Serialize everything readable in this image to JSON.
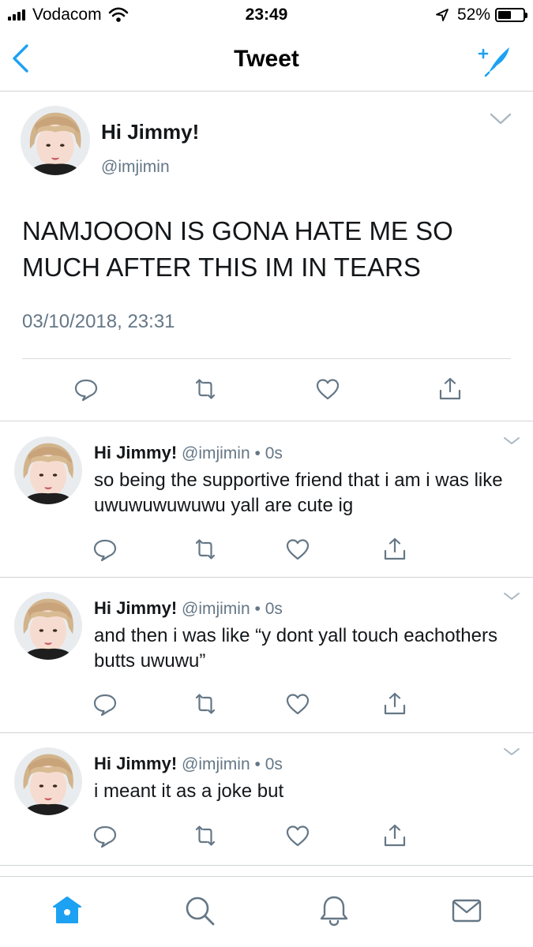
{
  "status_bar": {
    "carrier": "Vodacom",
    "time": "23:49",
    "battery": "52%",
    "battery_level": 0.52,
    "icons": [
      "signal-icon",
      "wifi-icon",
      "location-arrow-icon",
      "battery-icon"
    ]
  },
  "nav": {
    "title": "Tweet",
    "back_icon": "chevron-left-icon",
    "compose_icon": "compose-feather-icon"
  },
  "colors": {
    "accent": "#1da1f2",
    "secondary_text": "#657786",
    "divider": "#cfd3d6",
    "action_icon": "#657786"
  },
  "main_tweet": {
    "display_name": "Hi Jimmy!",
    "handle": "@imjimin",
    "text": "NAMJOOON IS GONA HATE ME SO MUCH AFTER THIS IM IN TEARS",
    "timestamp": "03/10/2018, 23:31"
  },
  "replies": [
    {
      "display_name": "Hi Jimmy!",
      "handle": "@imjimin",
      "dot": "•",
      "time": "0s",
      "text": "so being the supportive friend that i am i was like uwuwuwuwuwu yall are cute ig"
    },
    {
      "display_name": "Hi Jimmy!",
      "handle": "@imjimin",
      "dot": "•",
      "time": "0s",
      "text": "and then i was like “y dont yall touch eachothers butts uwuwu”"
    },
    {
      "display_name": "Hi Jimmy!",
      "handle": "@imjimin",
      "dot": "•",
      "time": "0s",
      "text": "i meant it as a joke but"
    }
  ],
  "actions": [
    "reply-icon",
    "retweet-icon",
    "like-icon",
    "share-icon"
  ],
  "tab_bar": {
    "tabs": [
      "home-icon",
      "search-icon",
      "notifications-icon",
      "messages-icon"
    ],
    "active": "home-icon"
  }
}
